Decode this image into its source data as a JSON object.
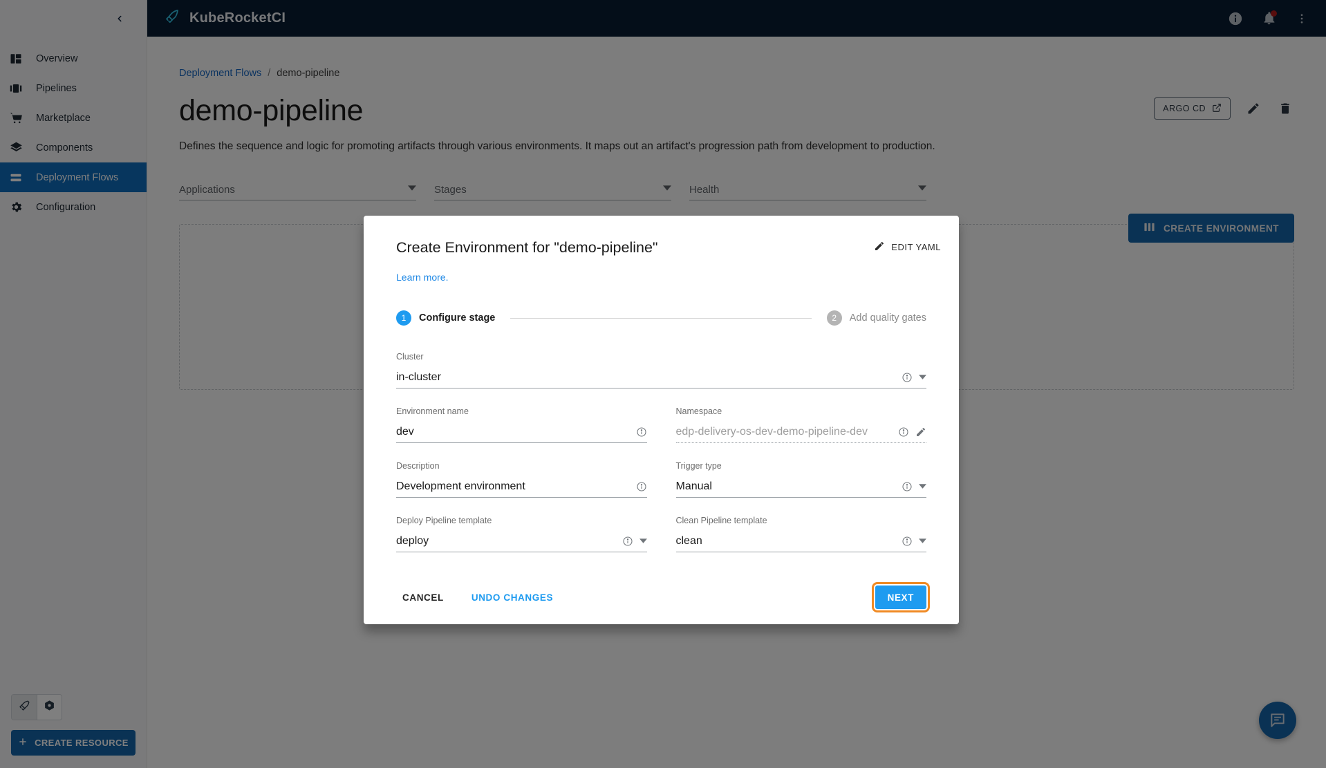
{
  "app": {
    "brand_name": "KubeRocketCI",
    "collapse_icon": "chevron-left-icon",
    "logo_icon": "rocket-icon"
  },
  "topbar": {
    "icons": [
      {
        "name": "info-icon",
        "label": "Info"
      },
      {
        "name": "notifications-bell-icon",
        "label": "Notifications"
      },
      {
        "name": "more-vertical-icon",
        "label": "More"
      }
    ]
  },
  "sidebar": {
    "items": [
      {
        "label": "Overview",
        "icon": "dashboard-icon",
        "active": false
      },
      {
        "label": "Pipelines",
        "icon": "pipelines-icon",
        "active": false
      },
      {
        "label": "Marketplace",
        "icon": "cart-icon",
        "active": false
      },
      {
        "label": "Components",
        "icon": "layers-icon",
        "active": false
      },
      {
        "label": "Deployment Flows",
        "icon": "flows-icon",
        "active": true
      },
      {
        "label": "Configuration",
        "icon": "gear-icon",
        "active": false
      }
    ],
    "toggles": [
      {
        "name": "rocket-view-toggle",
        "icon": "rocket-icon",
        "selected": true
      },
      {
        "name": "kubernetes-view-toggle",
        "icon": "kubernetes-icon",
        "selected": false
      }
    ],
    "create_resource_label": "CREATE RESOURCE"
  },
  "breadcrumb": {
    "parent": "Deployment Flows",
    "separator": "/",
    "current": "demo-pipeline"
  },
  "page": {
    "title": "demo-pipeline",
    "description": "Defines the sequence and logic for promoting artifacts through various environments. It maps out an artifact's progression path from development to production.",
    "argo_cd_label": "ARGO CD",
    "edit_icon": "pencil-icon",
    "delete_icon": "trash-icon",
    "external_link_icon": "external-link-icon"
  },
  "filters": [
    {
      "label": "Applications",
      "name": "applications-filter"
    },
    {
      "label": "Stages",
      "name": "stages-filter"
    },
    {
      "label": "Health",
      "name": "health-filter"
    }
  ],
  "create_environment_button": {
    "label": "CREATE ENVIRONMENT",
    "icon": "columns-icon"
  },
  "chat_fab": {
    "icon": "chat-bubble-icon"
  },
  "modal": {
    "title": "Create Environment for \"demo-pipeline\"",
    "edit_yaml_label": "EDIT YAML",
    "learn_more_label": "Learn more.",
    "steps": [
      {
        "num": "1",
        "label": "Configure stage",
        "active": true
      },
      {
        "num": "2",
        "label": "Add quality gates",
        "active": false
      }
    ],
    "fields": {
      "cluster": {
        "label": "Cluster",
        "value": "in-cluster",
        "placeholder": ""
      },
      "env_name": {
        "label": "Environment name",
        "value": "dev",
        "placeholder": ""
      },
      "namespace": {
        "label": "Namespace",
        "value": "",
        "placeholder": "edp-delivery-os-dev-demo-pipeline-dev"
      },
      "description": {
        "label": "Description",
        "value": "Development environment",
        "placeholder": ""
      },
      "trigger_type": {
        "label": "Trigger type",
        "value": "Manual",
        "placeholder": ""
      },
      "deploy_tpl": {
        "label": "Deploy Pipeline template",
        "value": "deploy",
        "placeholder": ""
      },
      "clean_tpl": {
        "label": "Clean Pipeline template",
        "value": "clean",
        "placeholder": ""
      }
    },
    "footer": {
      "cancel_label": "CANCEL",
      "undo_label": "UNDO CHANGES",
      "next_label": "NEXT"
    }
  },
  "colors": {
    "brand_dark": "#081c33",
    "accent_blue": "#1565a8",
    "step_blue": "#1e9bf0",
    "link_blue": "#1565c0",
    "highlight_orange": "#f08a24",
    "sidebar_active": "#0f6cbd"
  }
}
